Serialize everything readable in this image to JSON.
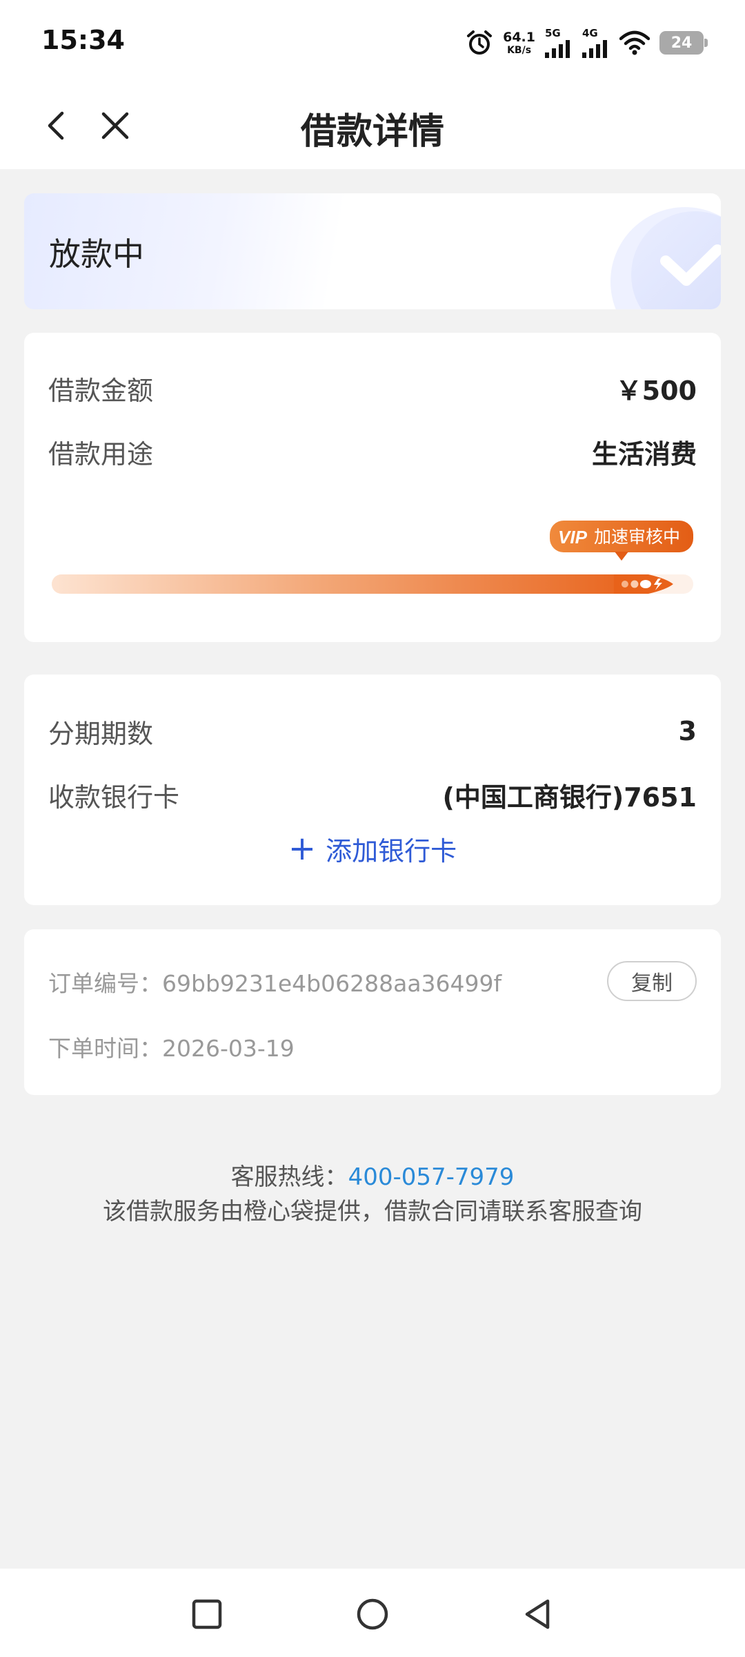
{
  "status_bar": {
    "time": "15:34",
    "net_speed_value": "64.1",
    "net_speed_unit": "KB/s",
    "sim1_label": "5G",
    "sim2_label": "4G",
    "battery": "24",
    "icons": [
      "alarm-icon",
      "signal-icon",
      "signal-icon",
      "wifi-icon",
      "battery-icon"
    ]
  },
  "nav": {
    "title": "借款详情",
    "back_icon": "chevron-left-icon",
    "close_icon": "close-icon"
  },
  "status_card": {
    "status": "放款中",
    "icon": "check-circle-icon"
  },
  "loan": {
    "amount_label": "借款金额",
    "amount_value": "￥500",
    "purpose_label": "借款用途",
    "purpose_value": "生活消费",
    "progress_badge_vip": "VIP",
    "progress_badge_text": "加速审核中",
    "progress_fraction": 0.93
  },
  "plan": {
    "installments_label": "分期期数",
    "installments_value": "3",
    "bank_label": "收款银行卡",
    "bank_value": "(中国工商银行)7651",
    "add_card_label": "添加银行卡"
  },
  "order": {
    "number_label": "订单编号：",
    "number_value": "69bb9231e4b06288aa36499f",
    "copy_label": "复制",
    "time_label": "下单时间：",
    "time_value": "2026-03-19"
  },
  "footer": {
    "hotline_label": "客服热线：",
    "hotline_number": "400-057-7979",
    "note": "该借款服务由橙心袋提供，借款合同请联系客服查询"
  },
  "colors": {
    "accent_orange": "#e8621a",
    "link_blue": "#2f5bd6",
    "phone_blue": "#2a8ad8"
  }
}
